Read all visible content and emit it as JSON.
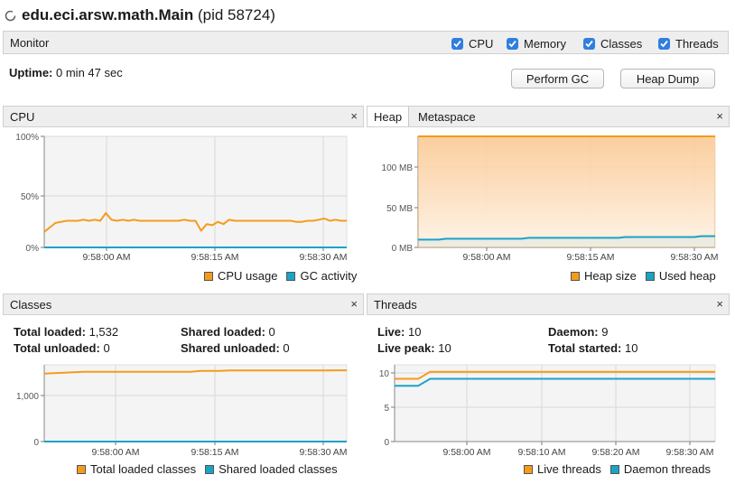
{
  "app": {
    "title": "edu.eci.arsw.math.Main",
    "pid": "(pid 58724)"
  },
  "monitor": {
    "label": "Monitor",
    "checks": [
      {
        "label": "CPU",
        "checked": true
      },
      {
        "label": "Memory",
        "checked": true
      },
      {
        "label": "Classes",
        "checked": true
      },
      {
        "label": "Threads",
        "checked": true
      }
    ]
  },
  "uptime": {
    "label": "Uptime:",
    "value": "0 min 47 sec"
  },
  "buttons": {
    "perform_gc": "Perform GC",
    "heap_dump": "Heap Dump"
  },
  "colors": {
    "orange": "#f59b1b",
    "blue": "#1aa3c7",
    "heap_fill": "#fbc88f"
  },
  "cpu": {
    "title": "CPU",
    "close": "×",
    "legend": [
      "CPU usage",
      "GC activity"
    ]
  },
  "heap": {
    "tabs": [
      "Heap",
      "Metaspace"
    ],
    "close": "×",
    "legend": [
      "Heap size",
      "Used heap"
    ]
  },
  "classes": {
    "title": "Classes",
    "close": "×",
    "stats": {
      "total_loaded_label": "Total loaded:",
      "total_loaded": "1,532",
      "shared_loaded_label": "Shared loaded:",
      "shared_loaded": "0",
      "total_unloaded_label": "Total unloaded:",
      "total_unloaded": "0",
      "shared_unloaded_label": "Shared unloaded:",
      "shared_unloaded": "0"
    },
    "legend": [
      "Total loaded classes",
      "Shared loaded classes"
    ]
  },
  "threads": {
    "title": "Threads",
    "close": "×",
    "stats": {
      "live_label": "Live:",
      "live": "10",
      "daemon_label": "Daemon:",
      "daemon": "9",
      "live_peak_label": "Live peak:",
      "live_peak": "10",
      "total_started_label": "Total started:",
      "total_started": "10"
    },
    "legend": [
      "Live threads",
      "Daemon threads"
    ]
  },
  "chart_data": [
    {
      "type": "line",
      "name": "cpu",
      "ylim": [
        0,
        100
      ],
      "y_ticks": [
        "100%",
        "50%",
        "0%"
      ],
      "x_ticks": [
        "9:58:00 AM",
        "9:58:15 AM",
        "9:58:30 AM"
      ],
      "series": [
        {
          "name": "CPU usage",
          "color": "#f59b1b",
          "values": [
            14,
            18,
            22,
            23,
            24,
            24,
            24,
            25,
            24,
            25,
            24,
            31,
            25,
            24,
            25,
            24,
            25,
            24,
            24,
            24,
            24,
            24,
            24,
            24,
            24,
            25,
            24,
            24,
            15,
            21,
            20,
            23,
            21,
            25,
            24,
            24,
            24,
            24,
            24,
            24,
            24,
            24,
            24,
            24,
            24,
            23,
            23,
            24,
            24,
            25,
            26,
            24,
            25,
            24,
            24
          ]
        },
        {
          "name": "GC activity",
          "color": "#1aa3c7",
          "values": [
            0,
            0
          ]
        }
      ]
    },
    {
      "type": "area",
      "name": "heap",
      "ylim": [
        0,
        128
      ],
      "y_ticks": [
        "100 MB",
        "50 MB",
        "0 MB"
      ],
      "x_ticks": [
        "9:58:00 AM",
        "9:58:15 AM",
        "9:58:30 AM"
      ],
      "series": [
        {
          "name": "Heap size",
          "color": "#f59b1b",
          "values": [
            128,
            128
          ]
        },
        {
          "name": "Used heap",
          "color": "#1aa3c7",
          "values": [
            9,
            9,
            9,
            9,
            10,
            10,
            10,
            10,
            10,
            10,
            10,
            10,
            10,
            10,
            10,
            10,
            11,
            11,
            11,
            11,
            11,
            11,
            11,
            11,
            11,
            11,
            11,
            11,
            11,
            11,
            12,
            12,
            12,
            12,
            12,
            12,
            12,
            12,
            12,
            12,
            12,
            13,
            13,
            13
          ]
        }
      ]
    },
    {
      "type": "line",
      "name": "classes",
      "ylim": [
        0,
        1650
      ],
      "y_ticks": [
        "1,000",
        "0"
      ],
      "x_ticks": [
        "9:58:00 AM",
        "9:58:15 AM",
        "9:58:30 AM"
      ],
      "series": [
        {
          "name": "Total loaded classes",
          "color": "#f59b1b",
          "values": [
            1460,
            1470,
            1480,
            1490,
            1500,
            1500,
            1500,
            1500,
            1500,
            1500,
            1500,
            1500,
            1500,
            1500,
            1500,
            1500,
            1520,
            1520,
            1520,
            1530,
            1530,
            1530,
            1530,
            1530,
            1530,
            1530,
            1530,
            1530,
            1530,
            1530,
            1532,
            1532
          ]
        },
        {
          "name": "Shared loaded classes",
          "color": "#1aa3c7",
          "values": [
            0,
            0
          ]
        }
      ]
    },
    {
      "type": "line",
      "name": "threads",
      "ylim": [
        0,
        11
      ],
      "y_ticks": [
        "10",
        "5",
        "0"
      ],
      "x_ticks": [
        "9:58:00 AM",
        "9:58:10 AM",
        "9:58:20 AM",
        "9:58:30 AM"
      ],
      "series": [
        {
          "name": "Live threads",
          "color": "#f59b1b",
          "values": [
            9,
            9,
            9,
            10,
            10,
            10,
            10,
            10,
            10,
            10,
            10,
            10,
            10,
            10,
            10,
            10,
            10,
            10,
            10,
            10,
            10,
            10,
            10,
            10,
            10,
            10,
            10,
            10
          ]
        },
        {
          "name": "Daemon threads",
          "color": "#1aa3c7",
          "values": [
            8,
            8,
            8,
            9,
            9,
            9,
            9,
            9,
            9,
            9,
            9,
            9,
            9,
            9,
            9,
            9,
            9,
            9,
            9,
            9,
            9,
            9,
            9,
            9,
            9,
            9,
            9,
            9
          ]
        }
      ]
    }
  ]
}
